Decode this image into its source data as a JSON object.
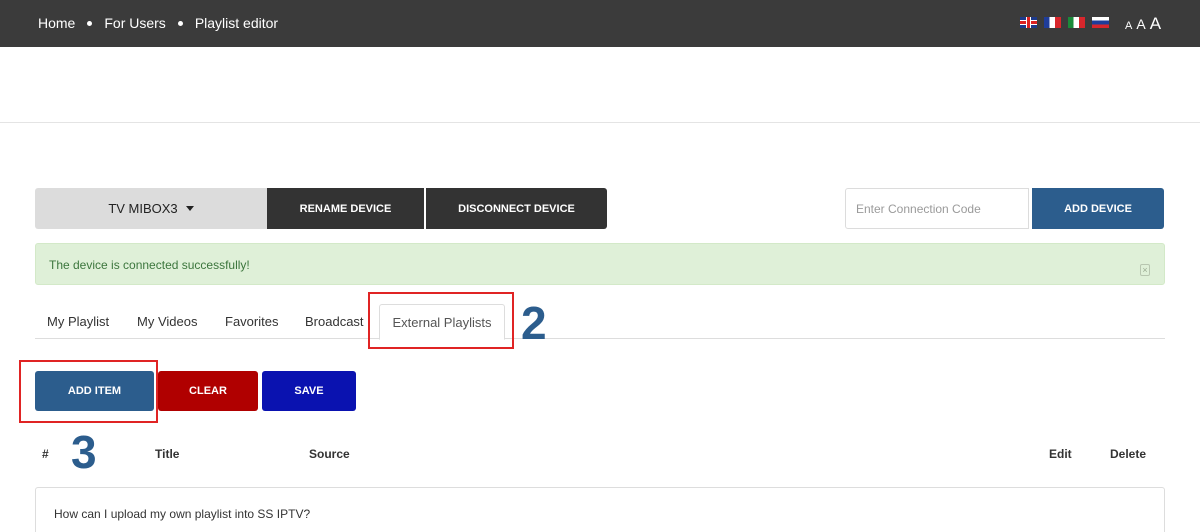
{
  "breadcrumb": {
    "items": [
      "Home",
      "For Users",
      "Playlist editor"
    ]
  },
  "languages": [
    "uk-flag-icon",
    "fr-flag-icon",
    "it-flag-icon",
    "ru-flag-icon"
  ],
  "font_size_controls": [
    "A",
    "A",
    "A"
  ],
  "device": {
    "selected": "TV MIBOX3",
    "rename_label": "RENAME DEVICE",
    "disconnect_label": "DISCONNECT DEVICE",
    "connection_code_placeholder": "Enter Connection Code",
    "add_device_label": "ADD DEVICE"
  },
  "alert": {
    "message": "The device is connected successfully!"
  },
  "tabs": [
    {
      "label": "My Playlist"
    },
    {
      "label": "My Videos"
    },
    {
      "label": "Favorites"
    },
    {
      "label": "Broadcast"
    },
    {
      "label": "External Playlists",
      "active": true
    }
  ],
  "annotations": {
    "tab_marker": "2",
    "add_item_marker": "3"
  },
  "actions": {
    "add_item_label": "ADD ITEM",
    "clear_label": "CLEAR",
    "save_label": "SAVE"
  },
  "table": {
    "columns": [
      "#",
      "Title",
      "Source",
      "Edit",
      "Delete"
    ],
    "rows": [
      {
        "text": "How can I upload my own playlist into SS IPTV?"
      }
    ]
  },
  "colors": {
    "topbar": "#3b3b3b",
    "primary": "#2c5d8d",
    "danger": "#b00000",
    "save": "#0a12b0",
    "success_bg": "#dff0d8",
    "annotation_red": "#e02424"
  }
}
